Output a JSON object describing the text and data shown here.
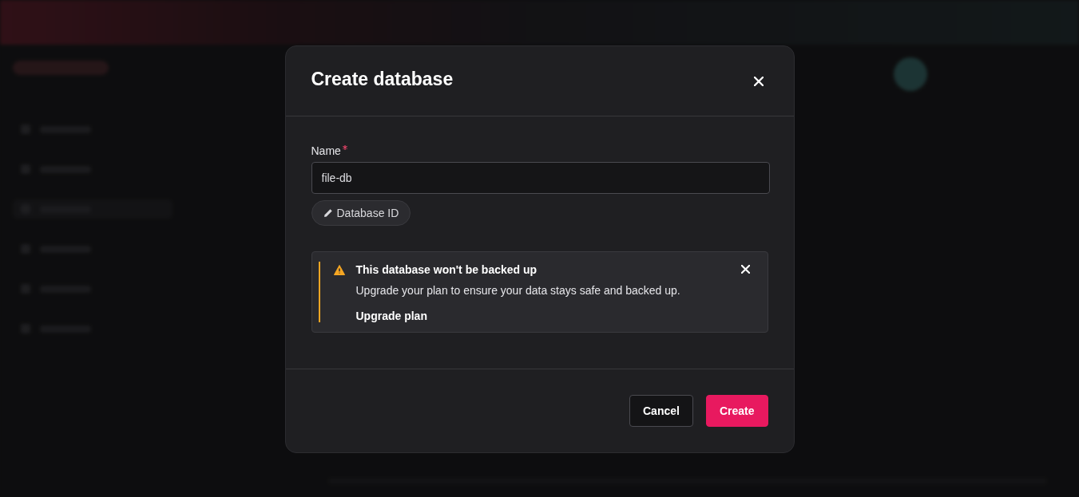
{
  "modal": {
    "title": "Create database",
    "name_field": {
      "label": "Name",
      "required": true,
      "value": "file-db"
    },
    "id_chip": {
      "label": "Database ID"
    },
    "alert": {
      "title": "This database won't be backed up",
      "message": "Upgrade your plan to ensure your data stays safe and backed up.",
      "action": "Upgrade plan"
    },
    "buttons": [
      {
        "label": "Cancel",
        "kind": "secondary"
      },
      {
        "label": "Create",
        "kind": "primary"
      }
    ]
  }
}
